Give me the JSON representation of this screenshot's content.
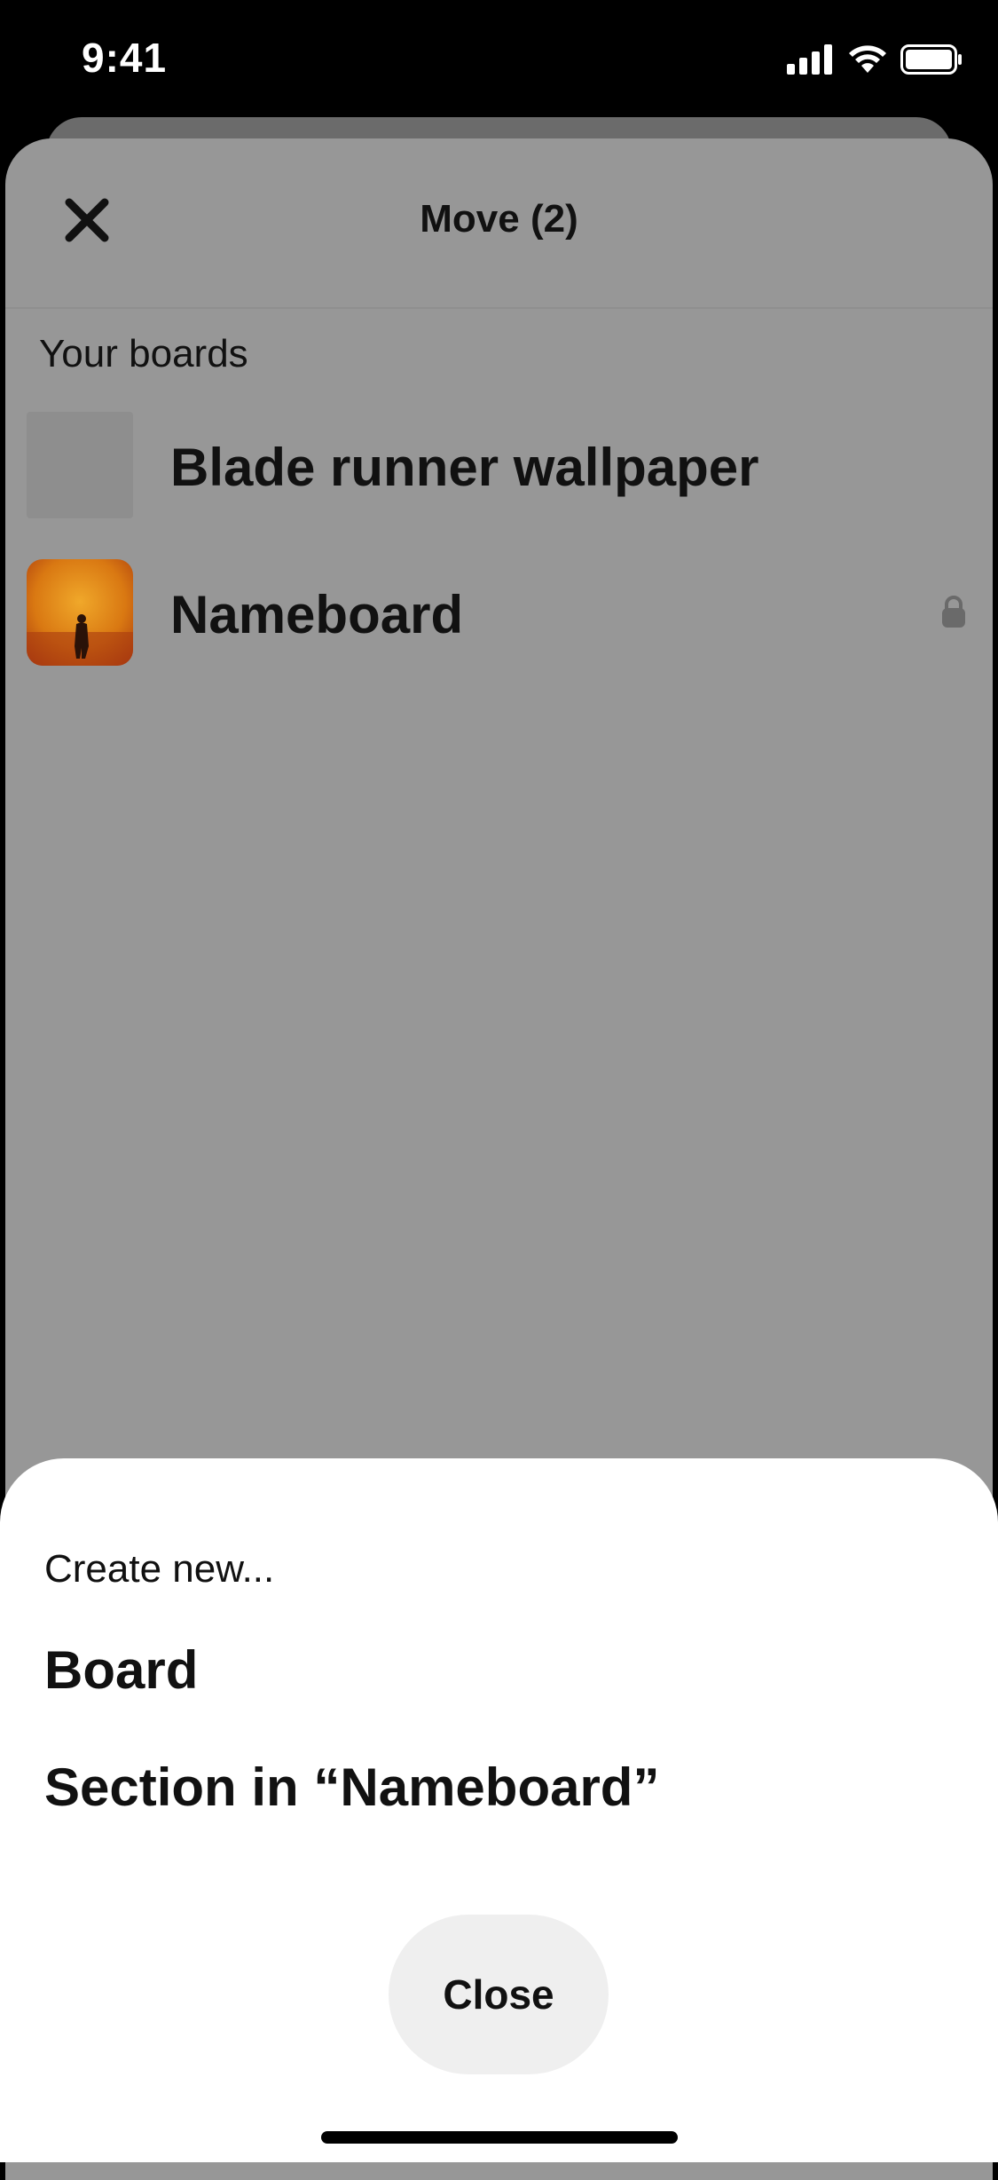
{
  "status_bar": {
    "time": "9:41"
  },
  "header": {
    "title": "Move (2)"
  },
  "boards": {
    "section_label": "Your boards",
    "items": [
      {
        "name": "Blade runner wallpaper",
        "thumbnail": "empty",
        "locked": false
      },
      {
        "name": "Nameboard",
        "thumbnail": "orange-desert-figure",
        "locked": true
      }
    ]
  },
  "create_sheet": {
    "label": "Create new...",
    "options": [
      "Board",
      "Section in “Nameboard”"
    ],
    "close_label": "Close"
  },
  "colors": {
    "overlay_sheet": "#979797",
    "bottom_sheet": "#ffffff",
    "close_button": "#efefef",
    "text": "#111111"
  }
}
